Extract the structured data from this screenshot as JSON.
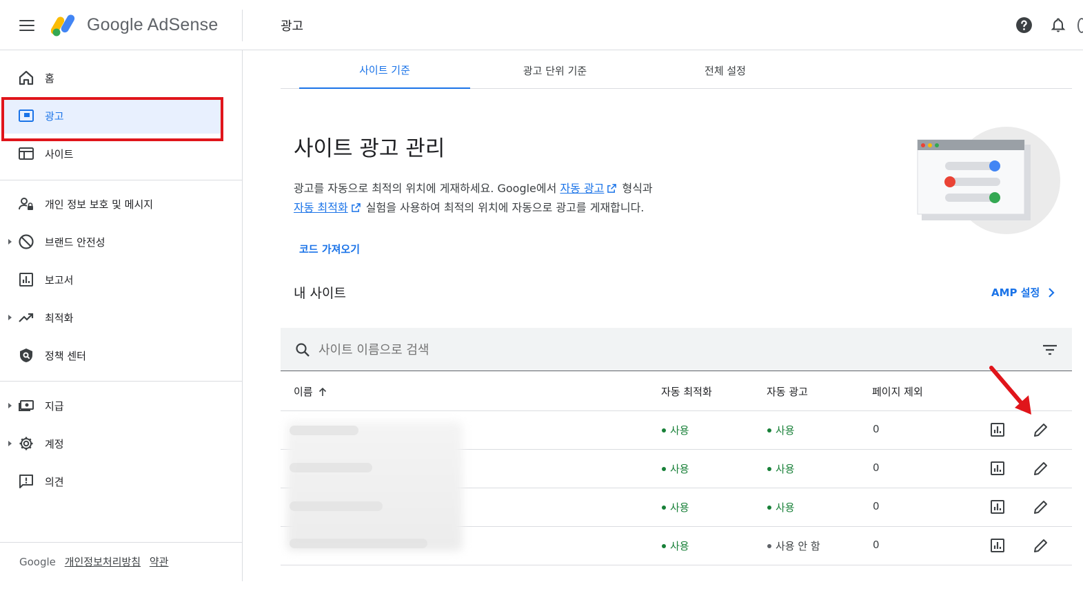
{
  "app": {
    "brand": "Google AdSense",
    "page_title": "광고"
  },
  "sidebar": {
    "items": [
      {
        "label": "홈",
        "icon": "home-icon"
      },
      {
        "label": "광고",
        "icon": "ads-icon",
        "active": true
      },
      {
        "label": "사이트",
        "icon": "sites-icon"
      },
      {
        "label": "개인 정보 보호 및 메시지",
        "icon": "privacy-icon"
      },
      {
        "label": "브랜드 안전성",
        "icon": "block-icon"
      },
      {
        "label": "보고서",
        "icon": "report-icon"
      },
      {
        "label": "최적화",
        "icon": "trending-icon"
      },
      {
        "label": "정책 센터",
        "icon": "policy-icon"
      },
      {
        "label": "지급",
        "icon": "payments-icon"
      },
      {
        "label": "계정",
        "icon": "gear-icon"
      },
      {
        "label": "의견",
        "icon": "feedback-icon"
      }
    ],
    "footer": {
      "brand": "Google",
      "privacy": "개인정보처리방침",
      "terms": "약관"
    }
  },
  "tabs": [
    {
      "label": "사이트 기준",
      "active": true
    },
    {
      "label": "광고 단위 기준"
    },
    {
      "label": "전체 설정"
    }
  ],
  "main": {
    "title": "사이트 광고 관리",
    "desc_part1": "광고를 자동으로 최적의 위치에 게재하세요. Google에서 ",
    "desc_link1": "자동 광고",
    "desc_part2": " 형식과",
    "desc_link2": "자동 최적화",
    "desc_part3": " 실험을 사용하여 최적의 위치에 자동으로 광고를 게재합니다.",
    "code_button": "코드 가져오기",
    "my_sites": "내 사이트",
    "amp_settings": "AMP 설정"
  },
  "search": {
    "placeholder": "사이트 이름으로 검색"
  },
  "table": {
    "headers": {
      "name": "이름",
      "auto_opt": "자동 최적화",
      "auto_ads": "자동 광고",
      "page_excl": "페이지 제외"
    },
    "rows": [
      {
        "auto_opt": "사용",
        "auto_ads": "사용",
        "auto_ads_on": true,
        "page_excl": "0"
      },
      {
        "auto_opt": "사용",
        "auto_ads": "사용",
        "auto_ads_on": true,
        "page_excl": "0"
      },
      {
        "auto_opt": "사용",
        "auto_ads": "사용",
        "auto_ads_on": true,
        "page_excl": "0"
      },
      {
        "auto_opt": "사용",
        "auto_ads": "사용 안 함",
        "auto_ads_on": false,
        "page_excl": "0"
      }
    ]
  },
  "colors": {
    "accent": "#1a73e8",
    "active_bg": "#e8f0fe",
    "status_green": "#188038",
    "highlight_red": "#e0151b"
  }
}
